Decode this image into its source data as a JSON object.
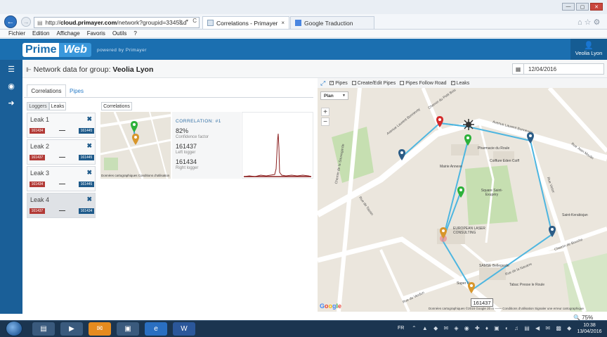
{
  "browser": {
    "url_prefix": "http://",
    "url_domain": "cloud.primayer.com",
    "url_rest": "/network?groupid=3345&d",
    "url_tools": "⌕ ▾ C",
    "tabs": [
      {
        "label": "Correlations - Primayer",
        "close": "×"
      },
      {
        "label": "Google Traduction"
      }
    ],
    "menu": [
      "Fichier",
      "Edition",
      "Affichage",
      "Favoris",
      "Outils",
      "?"
    ]
  },
  "app": {
    "logo_prime": "Prime",
    "logo_web": "Web",
    "powered_by": "powered by Primayer",
    "user": "Veolia Lyon"
  },
  "page": {
    "title_prefix": "Network data for group:",
    "group": "Veolia Lyon",
    "date": "12/04/2016"
  },
  "panel": {
    "tabs": [
      "Correlations",
      "Pipes"
    ],
    "subtabs": [
      "Loggers",
      "Leaks"
    ],
    "corr_tab": "Correlations",
    "leaks": [
      {
        "name": "Leak 1",
        "left": "161434",
        "right": "161445",
        "close": "✖",
        "sep": "—"
      },
      {
        "name": "Leak 2",
        "left": "161437",
        "right": "161445",
        "close": "✖",
        "sep": "—"
      },
      {
        "name": "Leak 3",
        "left": "161434",
        "right": "161445",
        "close": "✖",
        "sep": "—"
      },
      {
        "name": "Leak 4",
        "left": "161437",
        "right": "161434",
        "close": "✖",
        "sep": "—"
      }
    ],
    "minimap_attr": "Données cartographiques   Conditions d'utilisation",
    "correlation": {
      "title": "CORRELATION: #1",
      "factor": "82%",
      "factor_label": "Confidence factor",
      "left": "161437",
      "left_label": "Left logger",
      "right": "161434",
      "right_label": "Right logger"
    }
  },
  "map": {
    "toolbar": {
      "pipes": "Pipes",
      "create": "Create/Edit Pipes",
      "follow": "Pipes Follow Road",
      "leaks": "Leaks"
    },
    "type": "Plan",
    "zoom_in": "+",
    "zoom_out": "−",
    "labels": {
      "r1": "Avenue Laurent Bonnevay",
      "r2": "Chemin du Petit Bois",
      "r3": "Rue de Tassin",
      "r4": "Rue de Verdun",
      "r5": "Rue de la Navarre",
      "r6": "Rue Victor",
      "r7": "Chemin de Bouche",
      "r8": "Avenue Laurent Bonnevay",
      "r9": "Rue Jean Moulin",
      "r10": "Chemin de la Sauvegarde",
      "p1": "Pharmacie du Roule",
      "p2": "Coiffure Eden Coiff",
      "p3": "Square Saint-Exupéry",
      "p4": "Mairie Annexe",
      "p5": "EUROPEAN LASER CONSULTING",
      "p6": "SAMSE Bellegarde",
      "p7": "Tabac Presse le Roule",
      "p8": "Super U",
      "p9": "Saint-Kerabisjan"
    },
    "google": [
      "G",
      "o",
      "o",
      "g",
      "l",
      "e"
    ],
    "attribution": "Données cartographiques ©2016 Google   20 m ───   Conditions d'utilisation   Signaler une erreur cartographique",
    "tooltip": "161437",
    "zoom_level": "🔍 75%"
  },
  "taskbar": {
    "lang": "FR",
    "time": "10:38",
    "date": "13/04/2016"
  }
}
